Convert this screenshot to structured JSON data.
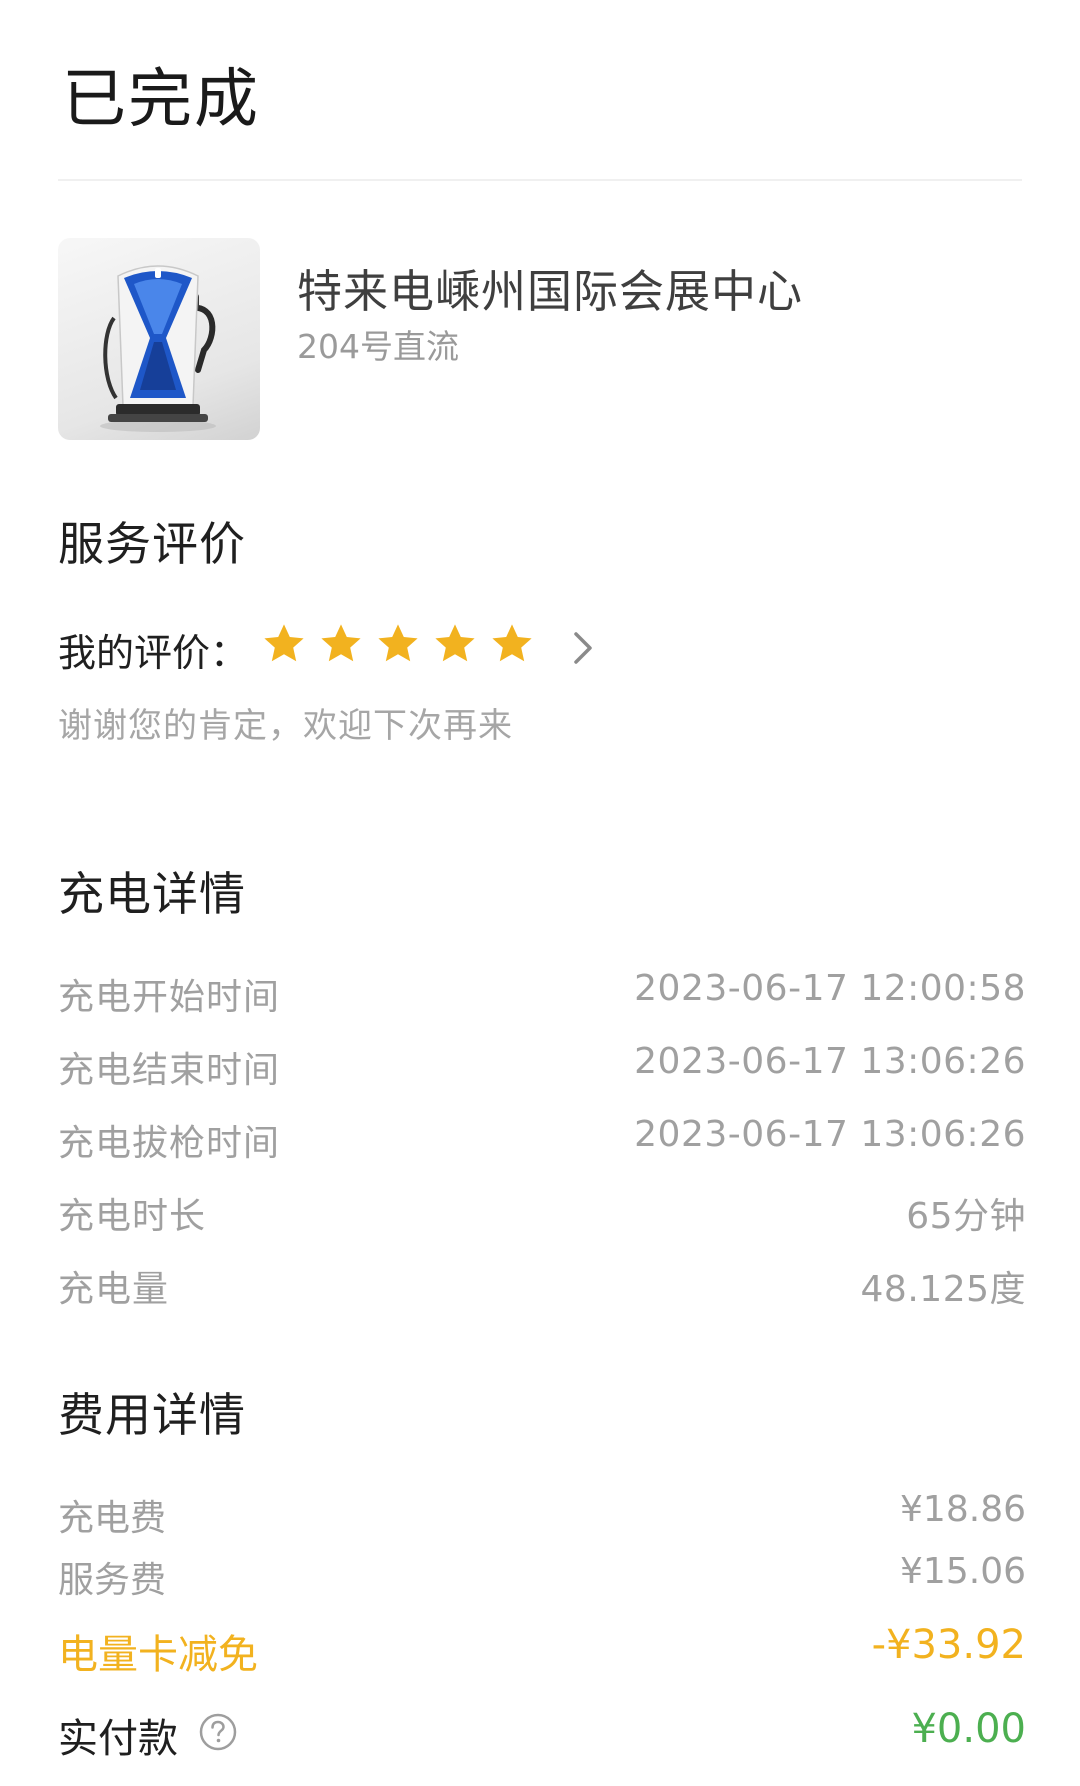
{
  "header": {
    "title": "已完成"
  },
  "station": {
    "name": "特来电嵊州国际会展中心",
    "pile": "204号直流"
  },
  "rating": {
    "section_title": "服务评价",
    "label": "我的评价：",
    "stars": 5,
    "star_color": "#f2b21f",
    "thanks": "谢谢您的肯定，欢迎下次再来"
  },
  "charging": {
    "section_title": "充电详情",
    "rows": [
      {
        "label": "充电开始时间",
        "value": "2023-06-17 12:00:58"
      },
      {
        "label": "充电结束时间",
        "value": "2023-06-17 13:06:26"
      },
      {
        "label": "充电拔枪时间",
        "value": "2023-06-17 13:06:26"
      },
      {
        "label": "充电时长",
        "value": "65分钟"
      },
      {
        "label": "充电量",
        "value": "48.125度"
      }
    ]
  },
  "fees": {
    "section_title": "费用详情",
    "charge_fee": {
      "label": "充电费",
      "value": "¥18.86"
    },
    "service_fee": {
      "label": "服务费",
      "value": "¥15.06"
    },
    "discount": {
      "label": "电量卡减免",
      "value": "-¥33.92",
      "color": "#f2b21f"
    },
    "paid": {
      "label": "实付款",
      "value": "¥0.00",
      "color": "#4caf50"
    }
  },
  "icons": {
    "star": "star-icon",
    "chevron": "chevron-right-icon",
    "help": "question-circle-icon",
    "station_image": "charging-pile-image"
  }
}
